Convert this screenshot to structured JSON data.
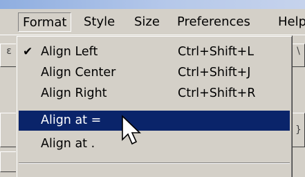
{
  "menubar": {
    "items": [
      "Format",
      "Style",
      "Size",
      "Preferences",
      "Help"
    ],
    "active": "Format"
  },
  "background": {
    "left_glyph_1": "ε",
    "right_glyph_1": "\\",
    "right_glyph_2": "}"
  },
  "format_menu": {
    "items": [
      {
        "label": "Align Left",
        "shortcut": "Ctrl+Shift+L",
        "checked": true
      },
      {
        "label": "Align Center",
        "shortcut": "Ctrl+Shift+J",
        "checked": false
      },
      {
        "label": "Align Right",
        "shortcut": "Ctrl+Shift+R",
        "checked": false
      },
      {
        "label": "Align at =",
        "shortcut": "",
        "checked": false,
        "highlighted": true
      },
      {
        "label": "Align at .",
        "shortcut": "",
        "checked": false
      }
    ],
    "check_glyph": "✔"
  },
  "colors": {
    "menu_bg": "#d4d0c8",
    "highlight": "#0a246a",
    "highlight_text": "#ffffff"
  }
}
